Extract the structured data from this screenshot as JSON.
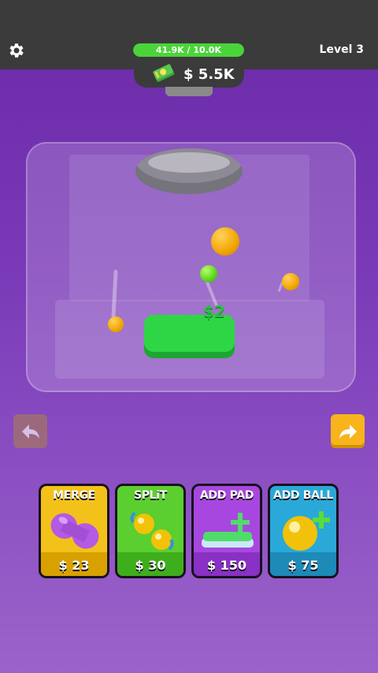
{
  "header": {
    "progress_text": "41.9K / 10.0K",
    "progress_fraction": 1.0,
    "level_label": "Level 3",
    "money": "$ 5.5K",
    "settings_icon": "gear-icon",
    "money_icon": "cash-stack-icon"
  },
  "game": {
    "pad_reward": "$2"
  },
  "controls": {
    "undo_icon": "back-arrow-icon",
    "redo_icon": "forward-arrow-icon"
  },
  "shop": [
    {
      "title": "MERGE",
      "price": "$ 23",
      "color": "#f3c21a",
      "icon": "merge-capsule-icon"
    },
    {
      "title": "SPLiT",
      "price": "$ 30",
      "color": "#5bcf2f",
      "icon": "split-balls-icon"
    },
    {
      "title": "ADD PAD",
      "price": "$ 150",
      "color": "#a747e0",
      "icon": "add-pad-icon"
    },
    {
      "title": "ADD BALL",
      "price": "$ 75",
      "color": "#2aa8d8",
      "icon": "add-ball-icon"
    }
  ],
  "colors": {
    "background": "#7a3ab8",
    "topbar": "#3b3b3b",
    "progress_green": "#4bd43a",
    "pad_green": "#2ed646",
    "coin_gold": "#f2a500"
  }
}
